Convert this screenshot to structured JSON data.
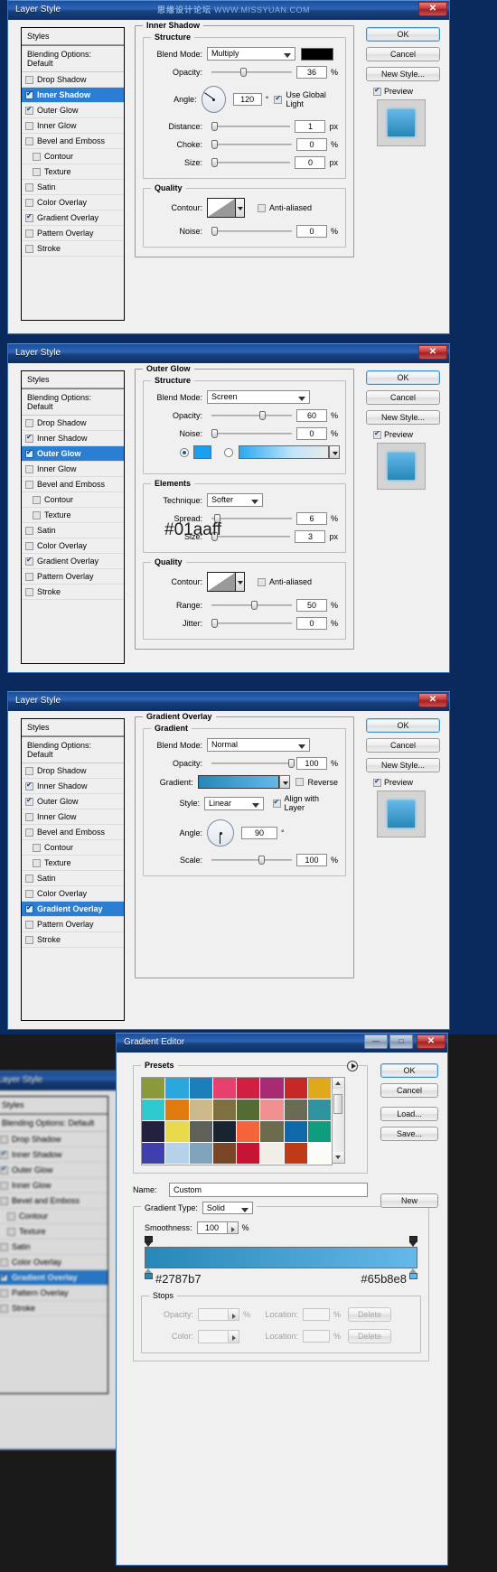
{
  "app": {
    "window_title": "Layer Style",
    "watermark_cn": "思缘设计论坛",
    "watermark_url": "WWW.MISSYUAN.COM",
    "close_glyph": "✕",
    "min_glyph": "—",
    "max_glyph": "□"
  },
  "styles_list": {
    "header": "Styles",
    "blending_options": "Blending Options: Default",
    "items": [
      {
        "label": "Drop Shadow",
        "checked": false,
        "sub": false
      },
      {
        "label": "Inner Shadow",
        "checked": true,
        "sub": false
      },
      {
        "label": "Outer Glow",
        "checked": true,
        "sub": false
      },
      {
        "label": "Inner Glow",
        "checked": false,
        "sub": false
      },
      {
        "label": "Bevel and Emboss",
        "checked": false,
        "sub": false
      },
      {
        "label": "Contour",
        "checked": false,
        "sub": true
      },
      {
        "label": "Texture",
        "checked": false,
        "sub": true
      },
      {
        "label": "Satin",
        "checked": false,
        "sub": false
      },
      {
        "label": "Color Overlay",
        "checked": false,
        "sub": false
      },
      {
        "label": "Gradient Overlay",
        "checked": true,
        "sub": false
      },
      {
        "label": "Pattern Overlay",
        "checked": false,
        "sub": false
      },
      {
        "label": "Stroke",
        "checked": false,
        "sub": false
      }
    ]
  },
  "buttons": {
    "ok": "OK",
    "cancel": "Cancel",
    "new_style": "New Style...",
    "preview": "Preview"
  },
  "panel1": {
    "active_index": 1,
    "section_title": "Inner Shadow",
    "structure_legend": "Structure",
    "quality_legend": "Quality",
    "blend_mode_label": "Blend Mode:",
    "blend_mode_value": "Multiply",
    "blend_color": "#000000",
    "opacity_label": "Opacity:",
    "opacity_value": "36",
    "opacity_unit": "%",
    "angle_label": "Angle:",
    "angle_value": "120",
    "angle_unit": "°",
    "use_global_light": "Use Global Light",
    "use_global_light_checked": true,
    "distance_label": "Distance:",
    "distance_value": "1",
    "distance_unit": "px",
    "choke_label": "Choke:",
    "choke_value": "0",
    "choke_unit": "%",
    "size_label": "Size:",
    "size_value": "0",
    "size_unit": "px",
    "contour_label": "Contour:",
    "anti_aliased": "Anti-aliased",
    "anti_aliased_checked": false,
    "noise_label": "Noise:",
    "noise_value": "0",
    "noise_unit": "%"
  },
  "panel2": {
    "active_index": 2,
    "section_title": "Outer Glow",
    "structure_legend": "Structure",
    "elements_legend": "Elements",
    "quality_legend": "Quality",
    "blend_mode_label": "Blend Mode:",
    "blend_mode_value": "Screen",
    "opacity_label": "Opacity:",
    "opacity_value": "60",
    "opacity_unit": "%",
    "noise_label": "Noise:",
    "noise_value": "0",
    "noise_unit": "%",
    "glow_color": "#01aaff",
    "glow_color_note": "#01aaff",
    "color_radio_selected": true,
    "gradient_radio_selected": false,
    "technique_label": "Technique:",
    "technique_value": "Softer",
    "spread_label": "Spread:",
    "spread_value": "6",
    "spread_unit": "%",
    "size_label": "Size:",
    "size_value": "3",
    "size_unit": "px",
    "contour_label": "Contour:",
    "anti_aliased": "Anti-aliased",
    "anti_aliased_checked": false,
    "range_label": "Range:",
    "range_value": "50",
    "range_unit": "%",
    "jitter_label": "Jitter:",
    "jitter_value": "0",
    "jitter_unit": "%"
  },
  "panel3": {
    "active_index": 9,
    "section_title": "Gradient Overlay",
    "gradient_legend": "Gradient",
    "blend_mode_label": "Blend Mode:",
    "blend_mode_value": "Normal",
    "opacity_label": "Opacity:",
    "opacity_value": "100",
    "opacity_unit": "%",
    "gradient_label": "Gradient:",
    "reverse_label": "Reverse",
    "reverse_checked": false,
    "style_label": "Style:",
    "style_value": "Linear",
    "align_label": "Align with Layer",
    "align_checked": true,
    "angle_label": "Angle:",
    "angle_value": "90",
    "angle_unit": "°",
    "scale_label": "Scale:",
    "scale_value": "100",
    "scale_unit": "%",
    "gradient_start": "#2787b7",
    "gradient_end": "#65b8e8"
  },
  "gradient_editor": {
    "window_title": "Gradient Editor",
    "presets_legend": "Presets",
    "name_label": "Name:",
    "name_value": "Custom",
    "gradient_type_label": "Gradient Type:",
    "gradient_type_value": "Solid",
    "smoothness_label": "Smoothness:",
    "smoothness_value": "100",
    "smoothness_unit": "%",
    "stops_legend": "Stops",
    "opacity_label": "Opacity:",
    "opacity_value": "",
    "opacity_unit": "%",
    "color_label": "Color:",
    "location_label_1": "Location:",
    "location_value_1": "",
    "location_label_2": "Location:",
    "location_value_2": "",
    "location_unit": "%",
    "delete_label_1": "Delete",
    "delete_label_2": "Delete",
    "buttons": {
      "ok": "OK",
      "cancel": "Cancel",
      "load": "Load...",
      "save": "Save...",
      "new": "New"
    },
    "stop_left_hex": "#2787b7",
    "stop_right_hex": "#65b8e8",
    "preset_colors": [
      "#8a9a3a",
      "#2aa7dd",
      "#1b7fba",
      "#e8406e",
      "#cf1f42",
      "#a82a72",
      "#c62727",
      "#e0a91c",
      "#2ec9cf",
      "#e27b0e",
      "#cbb98a",
      "#7d6f40",
      "#566b33",
      "#f09090",
      "#6b6b55",
      "#2f93a0",
      "#232040",
      "#e8d94a",
      "#60605a",
      "#1a2330",
      "#f4633a",
      "#6d6b4e",
      "#0f69a8",
      "#0f9c7f",
      "#3f3fae",
      "#b5d2ea",
      "#7fa3bb",
      "#7a4628",
      "#c51434",
      "#f0eee6",
      "#bf3a16",
      "#fbfbf8"
    ]
  },
  "background_panel": {
    "window_title": "Layer Style",
    "header": "Styles",
    "blending_options": "Blending Options: Default",
    "items": [
      "Drop Shadow",
      "Inner Shadow",
      "Outer Glow",
      "Inner Glow",
      "Bevel and Emboss",
      "Contour",
      "Texture",
      "Satin",
      "Color Overlay",
      "Gradient Overlay",
      "Pattern Overlay",
      "Stroke"
    ]
  }
}
